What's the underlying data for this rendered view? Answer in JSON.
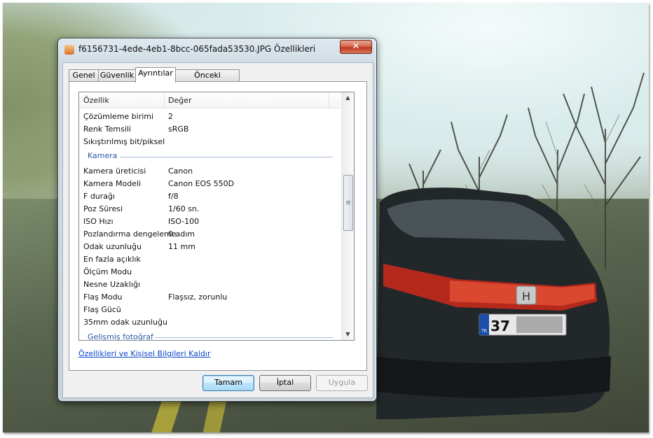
{
  "window": {
    "title": "f6156731-4ede-4eb1-8bcc-065fada53530.JPG Özellikleri",
    "close_glyph": "✕"
  },
  "tabs": [
    {
      "label": "Genel"
    },
    {
      "label": "Güvenlik"
    },
    {
      "label": "Ayrıntılar"
    },
    {
      "label": "Önceki Sürümler"
    }
  ],
  "active_tab": "Ayrıntılar",
  "columns": {
    "property": "Özellik",
    "value": "Değer"
  },
  "rows_top": [
    {
      "key": "Çözümleme birimi",
      "value": "2"
    },
    {
      "key": "Renk Temsili",
      "value": "sRGB"
    },
    {
      "key": "Sıkıştırılmış bit/piksel",
      "value": ""
    }
  ],
  "group_camera": "Kamera",
  "rows_camera": [
    {
      "key": "Kamera üreticisi",
      "value": "Canon"
    },
    {
      "key": "Kamera Modeli",
      "value": "Canon EOS 550D"
    },
    {
      "key": "F durağı",
      "value": "f/8"
    },
    {
      "key": "Poz Süresi",
      "value": "1/60 sn."
    },
    {
      "key": "ISO Hızı",
      "value": "ISO-100"
    },
    {
      "key": "Pozlandırma dengeleme",
      "value": "0 adım"
    },
    {
      "key": "Odak uzunluğu",
      "value": "11 mm"
    },
    {
      "key": "En fazla açıklık",
      "value": ""
    },
    {
      "key": "Ölçüm Modu",
      "value": ""
    },
    {
      "key": "Nesne Uzaklığı",
      "value": ""
    },
    {
      "key": "Flaş Modu",
      "value": "Flaşsız, zorunlu"
    },
    {
      "key": "Flaş Gücü",
      "value": ""
    },
    {
      "key": "35mm odak uzunluğu",
      "value": ""
    }
  ],
  "group_advanced": "Gelişmiş fotoğraf",
  "scroll": {
    "up_glyph": "▲",
    "down_glyph": "▼"
  },
  "remove_link": "Özellikleri ve Kişisel Bilgileri Kaldır",
  "buttons": {
    "ok": "Tamam",
    "cancel": "İptal",
    "apply": "Uygula"
  },
  "background": {
    "plate_country": "TR",
    "plate_number": "37"
  }
}
